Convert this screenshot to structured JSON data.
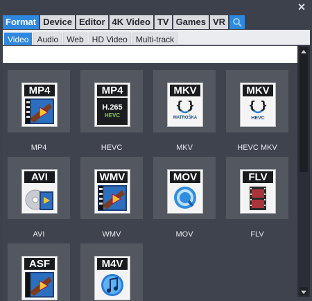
{
  "window": {
    "close_glyph": "×"
  },
  "top_tabs": [
    {
      "label": "Format",
      "active": true
    },
    {
      "label": "Device",
      "active": false
    },
    {
      "label": "Editor",
      "active": false
    },
    {
      "label": "4K Video",
      "active": false
    },
    {
      "label": "TV",
      "active": false
    },
    {
      "label": "Games",
      "active": false
    },
    {
      "label": "VR",
      "active": false
    }
  ],
  "sub_tabs": [
    {
      "label": "Video",
      "active": true
    },
    {
      "label": "Audio",
      "active": false
    },
    {
      "label": "Web",
      "active": false
    },
    {
      "label": "HD Video",
      "active": false
    },
    {
      "label": "Multi-track",
      "active": false
    }
  ],
  "formats": [
    {
      "tag": "MP4",
      "label": "MP4",
      "icon": "film-play-icon"
    },
    {
      "tag": "MP4",
      "label": "HEVC",
      "icon": "h265-hevc-icon",
      "badge": "H.265",
      "sub": "HEVC"
    },
    {
      "tag": "MKV",
      "label": "MKV",
      "icon": "matroska-icon",
      "sub": "MATROŠKA"
    },
    {
      "tag": "MKV",
      "label": "HEVC MKV",
      "icon": "matroska-hevc-icon",
      "sub": "HEVC"
    },
    {
      "tag": "AVI",
      "label": "AVI",
      "icon": "disc-film-icon"
    },
    {
      "tag": "WMV",
      "label": "WMV",
      "icon": "film-play-icon"
    },
    {
      "tag": "MOV",
      "label": "MOV",
      "icon": "quicktime-icon"
    },
    {
      "tag": "FLV",
      "label": "FLV",
      "icon": "film-strip-icon"
    },
    {
      "tag": "ASF",
      "label": "",
      "icon": "film-play-icon"
    },
    {
      "tag": "M4V",
      "label": "",
      "icon": "itunes-note-icon"
    }
  ],
  "colors": {
    "accent": "#2f88df",
    "background": "#3d414c",
    "tile": "#53575f"
  }
}
